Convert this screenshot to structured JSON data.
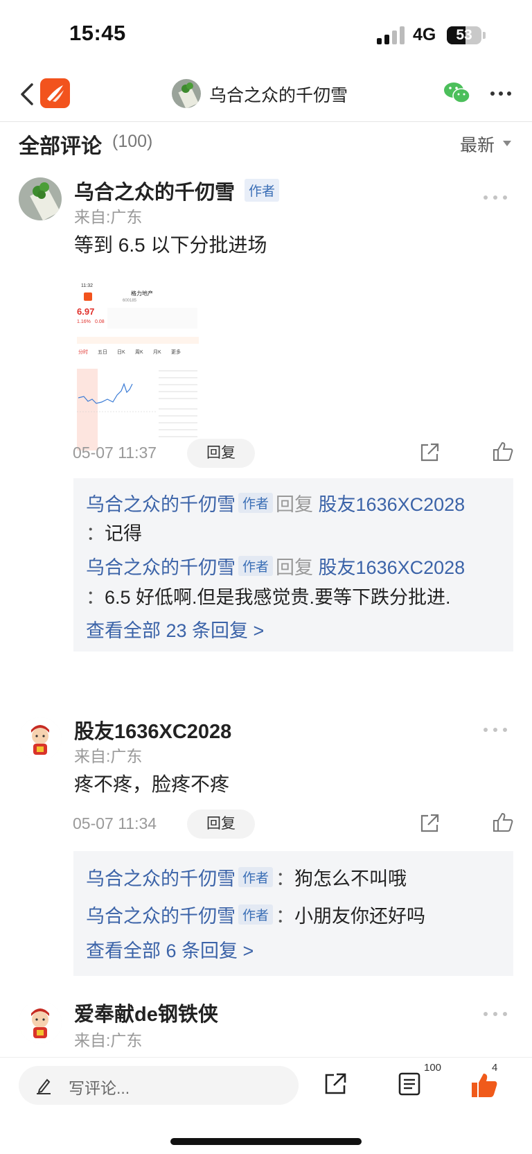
{
  "status_bar": {
    "time": "15:45",
    "network": "4G",
    "battery": "53",
    "battery_level": 0.53
  },
  "nav": {
    "title": "乌合之众的千仞雪"
  },
  "header": {
    "title": "全部评论",
    "count": "(100)",
    "sort": "最新"
  },
  "comments": [
    {
      "name": "乌合之众的千仞雪",
      "badge": "作者",
      "origin": "来自:广东",
      "text": "等到 6.5 以下分批进场",
      "time": "05-07 11:37",
      "reply_label": "回复",
      "thumbnail": {
        "time": "11:32",
        "stock_name": "格力地产",
        "stock_code": "600185",
        "price": "6.97",
        "change": "1.16%",
        "change_abs": "0.08",
        "tabs": [
          "分时",
          "五日",
          "日K",
          "周K",
          "月K",
          "更多"
        ]
      },
      "replies": [
        {
          "name": "乌合之众的千仞雪",
          "badge": "作者",
          "word": "回复",
          "target": "股友1636XC2028",
          "colon": "：",
          "text": "记得"
        },
        {
          "name": "乌合之众的千仞雪",
          "badge": "作者",
          "word": "回复",
          "target": "股友1636XC2028",
          "colon": "：",
          "text": "6.5 好低啊.但是我感觉贵.要等下跌分批进."
        }
      ],
      "view_all": "查看全部 23 条回复 >"
    },
    {
      "name": "股友1636XC2028",
      "origin": "来自:广东",
      "text": "疼不疼，脸疼不疼",
      "time": "05-07 11:34",
      "reply_label": "回复",
      "replies": [
        {
          "name": "乌合之众的千仞雪",
          "badge": "作者",
          "colon": "：",
          "text": "狗怎么不叫哦"
        },
        {
          "name": "乌合之众的千仞雪",
          "badge": "作者",
          "colon": "：",
          "text": "小朋友你还好吗"
        }
      ],
      "view_all": "查看全部 6 条回复 >"
    },
    {
      "name": "爱奉献de钢铁侠",
      "origin": "来自:广东"
    }
  ],
  "bottom_bar": {
    "placeholder": "写评论...",
    "comment_count": "100",
    "like_count": "4"
  },
  "colors": {
    "accent": "#f2531d",
    "link": "#3b63a8",
    "like": "#f05a1a"
  },
  "icons": [
    "back-icon",
    "app-logo-icon",
    "wechat-icon",
    "more-icon",
    "share-icon",
    "like-icon",
    "pen-icon",
    "list-icon"
  ]
}
